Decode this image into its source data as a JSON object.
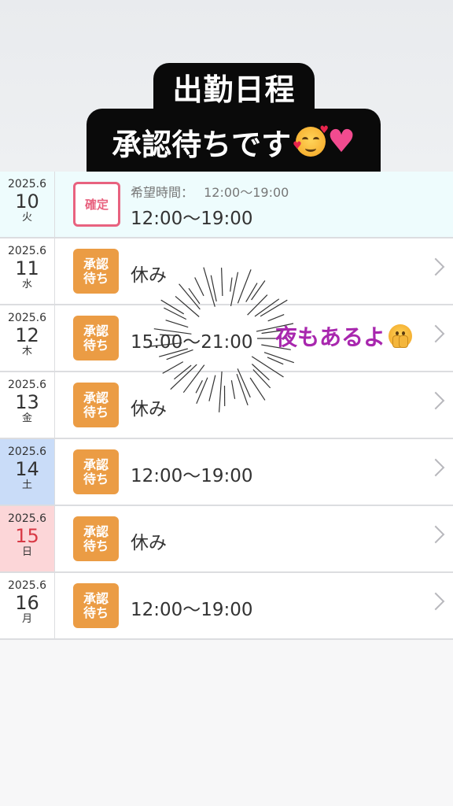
{
  "header": {
    "title_line1": "出勤日程",
    "title_line2": "承認待ちです",
    "emoji_1": "smiling-face-with-hearts",
    "emoji_2": "pink-heart"
  },
  "note": {
    "text": "夜もあるよ",
    "emoji": "face-with-open-eyes-and-hand-over-mouth"
  },
  "rows": [
    {
      "ym": "2025.6",
      "day": "10",
      "weekday": "火",
      "status_line1": "確定",
      "status_line2": "",
      "hope_label": "希望時間：",
      "hope_time": "12:00〜19:00",
      "text": "12:00〜19:00"
    },
    {
      "ym": "2025.6",
      "day": "11",
      "weekday": "水",
      "status_line1": "承認",
      "status_line2": "待ち",
      "text": "休み"
    },
    {
      "ym": "2025.6",
      "day": "12",
      "weekday": "木",
      "status_line1": "承認",
      "status_line2": "待ち",
      "text": "15:00〜21:00"
    },
    {
      "ym": "2025.6",
      "day": "13",
      "weekday": "金",
      "status_line1": "承認",
      "status_line2": "待ち",
      "text": "休み"
    },
    {
      "ym": "2025.6",
      "day": "14",
      "weekday": "土",
      "status_line1": "承認",
      "status_line2": "待ち",
      "text": "12:00〜19:00"
    },
    {
      "ym": "2025.6",
      "day": "15",
      "weekday": "日",
      "status_line1": "承認",
      "status_line2": "待ち",
      "text": "休み"
    },
    {
      "ym": "2025.6",
      "day": "16",
      "weekday": "月",
      "status_line1": "承認",
      "status_line2": "待ち",
      "text": "12:00〜19:00"
    }
  ],
  "colors": {
    "pending_badge": "#eb9c44",
    "confirmed_border": "#e8627f",
    "saturday_bg": "#c9dcf8",
    "sunday_bg": "#fcd6d8",
    "note_text": "#a827ae"
  }
}
